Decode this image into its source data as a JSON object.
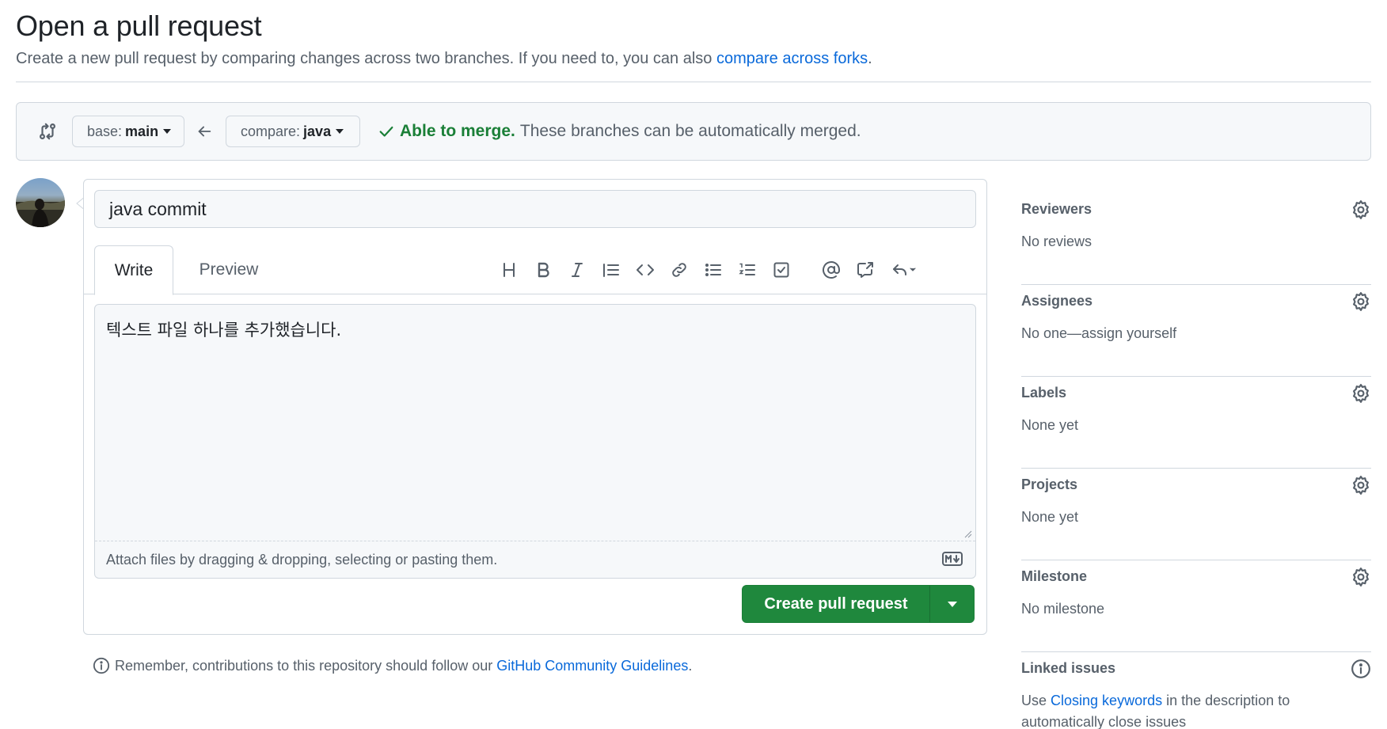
{
  "header": {
    "title": "Open a pull request",
    "subtitle": "Create a new pull request by comparing changes across two branches. If you need to, you can also",
    "subtitle_link": "compare across forks",
    "subtitle_end": "."
  },
  "compare": {
    "base_label": "base:",
    "base_branch": "main",
    "compare_label": "compare:",
    "compare_branch": "java",
    "merge_ok": "Able to merge.",
    "merge_text": "These branches can be automatically merged."
  },
  "form": {
    "title_value": "java commit",
    "tabs": [
      "Write",
      "Preview"
    ],
    "toolbar_icons": [
      "heading-icon",
      "bold-icon",
      "italic-icon",
      "quote-icon",
      "code-icon",
      "link-icon",
      "bulleted-list-icon",
      "numbered-list-icon",
      "task-list-icon",
      "mention-icon",
      "cross-reference-icon",
      "reply-icon"
    ],
    "body_text": "텍스트 파일 하나를 추가했습니다.",
    "attach_text": "Attach files by dragging & dropping, selecting or pasting them.",
    "submit_label": "Create pull request"
  },
  "guidelines": {
    "text": "Remember, contributions to this repository should follow our",
    "link": "GitHub Community Guidelines",
    "end": "."
  },
  "sidebar": {
    "reviewers": {
      "heading": "Reviewers",
      "value": "No reviews"
    },
    "assignees": {
      "heading": "Assignees",
      "value": "No one—assign yourself"
    },
    "labels": {
      "heading": "Labels",
      "value": "None yet"
    },
    "projects": {
      "heading": "Projects",
      "value": "None yet"
    },
    "milestone": {
      "heading": "Milestone",
      "value": "No milestone"
    },
    "linked_issues": {
      "heading": "Linked issues",
      "value_pre": "Use",
      "value_link": "Closing keywords",
      "value_post": "in the description to automatically close issues"
    }
  },
  "colors": {
    "accent": "#0969da",
    "success": "#1a7f37",
    "button": "#1f883d",
    "muted": "#57606a"
  }
}
